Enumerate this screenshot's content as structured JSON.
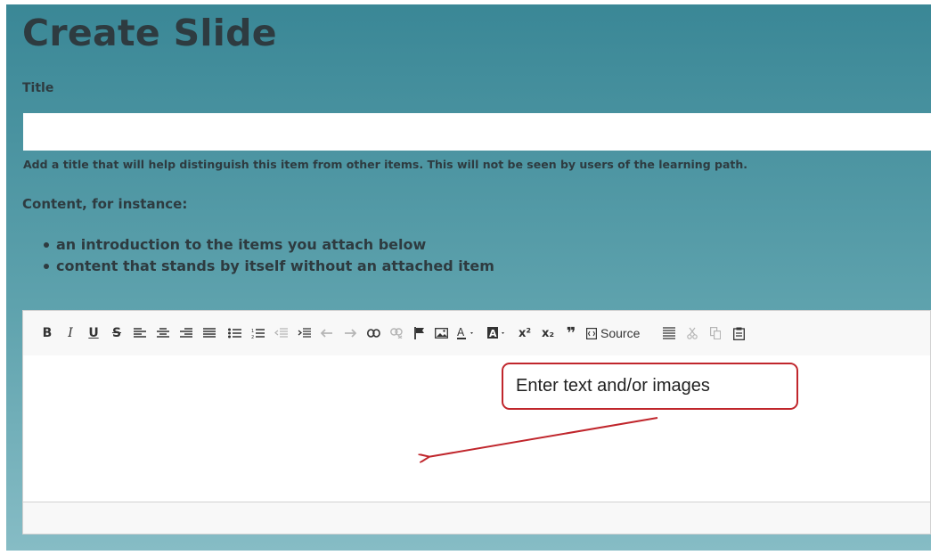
{
  "page": {
    "heading": "Create Slide",
    "title_label": "Title",
    "title_input": {
      "value": "",
      "placeholder": ""
    },
    "help_text": "Add a title that will help distinguish this item from other items. This will not be seen by users of the learning path.",
    "content_label": "Content, for instance:",
    "content_examples": [
      "an introduction to the items you attach below",
      "content that stands by itself without an attached item"
    ]
  },
  "toolbar": {
    "bold": "B",
    "italic": "I",
    "underline": "U",
    "strike": "S",
    "superscript": "x²",
    "subscript": "x₂",
    "blockquote": "❞",
    "source_label": "Source",
    "icons": [
      "bold-icon",
      "italic-icon",
      "underline-icon",
      "strikethrough-icon",
      "align-left-icon",
      "align-center-icon",
      "align-right-icon",
      "align-justify-icon",
      "bulleted-list-icon",
      "numbered-list-icon",
      "outdent-icon",
      "indent-icon",
      "undo-icon",
      "redo-icon",
      "link-icon",
      "unlink-icon",
      "anchor-flag-icon",
      "image-icon",
      "text-color-icon",
      "background-color-icon",
      "superscript-icon",
      "subscript-icon",
      "blockquote-icon",
      "source-icon",
      "horizontal-rule-icon",
      "cut-icon",
      "copy-icon",
      "paste-icon"
    ]
  },
  "annotation": {
    "callout_text": "Enter text and/or images",
    "color": "#c0262c"
  },
  "colors": {
    "gradient_top": "#3a8796",
    "gradient_bottom": "#86bcc5",
    "text_dark": "#2e3b40"
  }
}
